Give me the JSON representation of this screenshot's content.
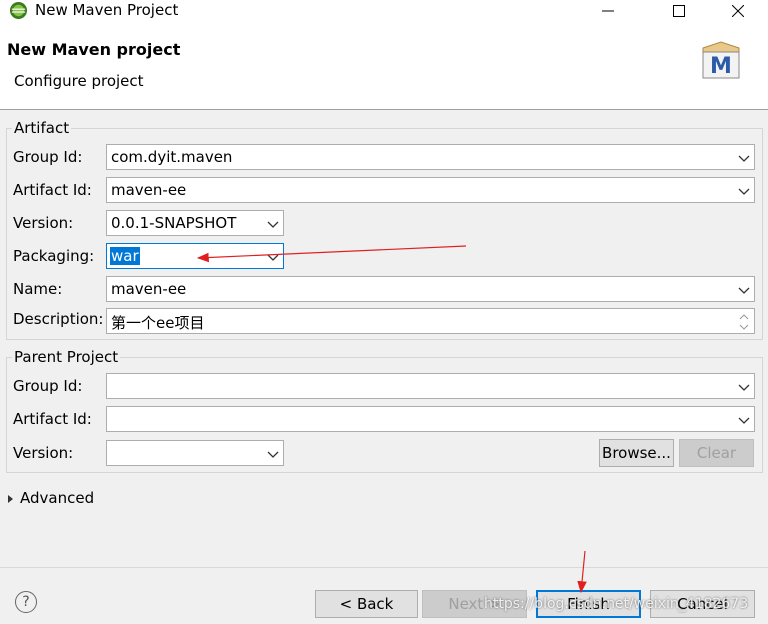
{
  "window": {
    "title": "New Maven Project",
    "minimize_glyph": "—",
    "maximize_glyph": "☐",
    "close_glyph": "✕"
  },
  "header": {
    "title": "New Maven project",
    "subtitle": "Configure project",
    "logo_letter": "M"
  },
  "artifact": {
    "legend": "Artifact",
    "group_id": {
      "label": "Group Id:",
      "value": "com.dyit.maven"
    },
    "artifact_id": {
      "label": "Artifact Id:",
      "value": "maven-ee"
    },
    "version": {
      "label": "Version:",
      "value": "0.0.1-SNAPSHOT"
    },
    "packaging": {
      "label": "Packaging:",
      "value": "war"
    },
    "name": {
      "label": "Name:",
      "value": "maven-ee"
    },
    "description": {
      "label": "Description:",
      "value": "第一个ee项目"
    }
  },
  "parent": {
    "legend": "Parent Project",
    "group_id": {
      "label": "Group Id:",
      "value": ""
    },
    "artifact_id": {
      "label": "Artifact Id:",
      "value": ""
    },
    "version": {
      "label": "Version:",
      "value": ""
    },
    "browse_label": "Browse...",
    "clear_label": "Clear"
  },
  "advanced": {
    "label": "Advanced"
  },
  "footer": {
    "help_glyph": "?",
    "back_label": "< Back",
    "next_label": "Next >",
    "finish_label": "Finish",
    "cancel_label": "Cancel"
  },
  "watermark": "https://blog.csdn.net/weixin_4182673",
  "colors": {
    "accent": "#0078d7",
    "annotation_arrow": "#e02020",
    "background": "#f0f0f0"
  }
}
